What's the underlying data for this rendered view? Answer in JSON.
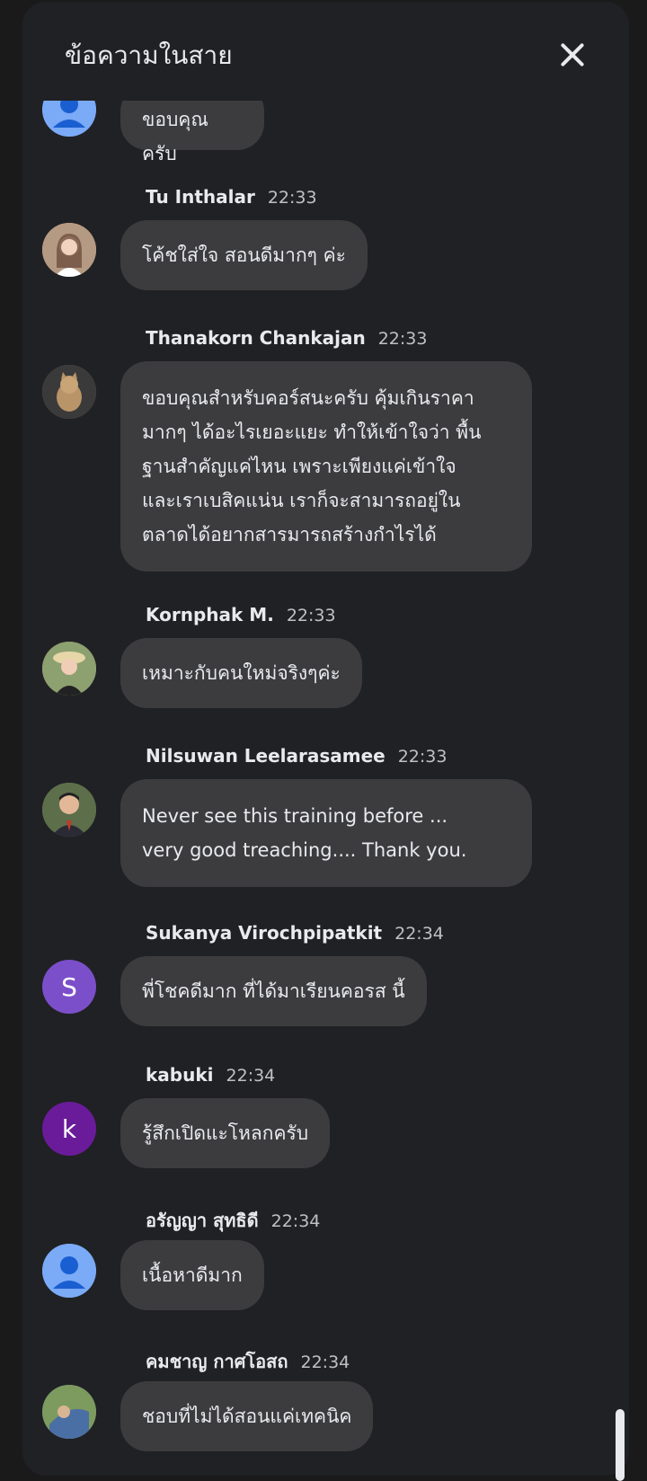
{
  "header": {
    "title": "ข้อความในสาย",
    "close_icon": "close-icon"
  },
  "messages": [
    {
      "name": "",
      "time": "",
      "text": "ขอบคุณครับ",
      "avatar": {
        "type": "person-icon",
        "color": "#7baaf7"
      }
    },
    {
      "name": "Tu Inthalar",
      "time": "22:33",
      "text": "โค้ชใส่ใจ สอนดีมากๆ ค่ะ",
      "avatar": {
        "type": "photo",
        "color": "#c9a38f"
      }
    },
    {
      "name": "Thanakorn Chankajan",
      "time": "22:33",
      "text": "ขอบคุณสำหรับคอร์สนะครับ คุ้มเกินราคา\nมากๆ ได้อะไรเยอะแยะ ทำให้เข้าใจว่า พื้น\nฐานสำคัญแค่ไหน เพราะเพียงแค่เข้าใจ\nและเราเบสิคแน่น เราก็จะสามารถอยู่ใน\nตลาดได้อยากสารมารถสร้างกำไรได้",
      "avatar": {
        "type": "photo",
        "color": "#8a7a62"
      }
    },
    {
      "name": "Kornphak M.",
      "time": "22:33",
      "text": "เหมาะกับคนใหม่จริงๆค่ะ",
      "avatar": {
        "type": "photo",
        "color": "#a8a27e"
      }
    },
    {
      "name": "Nilsuwan Leelarasamee",
      "time": "22:33",
      "text": "Never see this training before ...\nvery good treaching.... Thank you.",
      "avatar": {
        "type": "photo",
        "color": "#6b7a5a"
      }
    },
    {
      "name": "Sukanya Virochpipatkit",
      "time": "22:34",
      "text": "พี่โชคดีมาก ที่ได้มาเรียนคอรส นี้",
      "avatar": {
        "type": "letter",
        "letter": "S",
        "color": "#7b4fc9"
      }
    },
    {
      "name": "kabuki",
      "time": "22:34",
      "text": "รู้สึกเปิดแะโหลกครับ",
      "avatar": {
        "type": "letter",
        "letter": "k",
        "color": "#6a1b9a"
      }
    },
    {
      "name": "อรัญญา สุทธิดี",
      "time": "22:34",
      "text": "เนื้อหาดีมาก",
      "avatar": {
        "type": "person-icon",
        "color": "#7baaf7"
      }
    },
    {
      "name": "คมชาญ กาศโอสถ",
      "time": "22:34",
      "text": "ชอบที่ไม่ได้สอนแค่เทคนิค",
      "avatar": {
        "type": "photo",
        "color": "#5c7fa8"
      }
    }
  ]
}
